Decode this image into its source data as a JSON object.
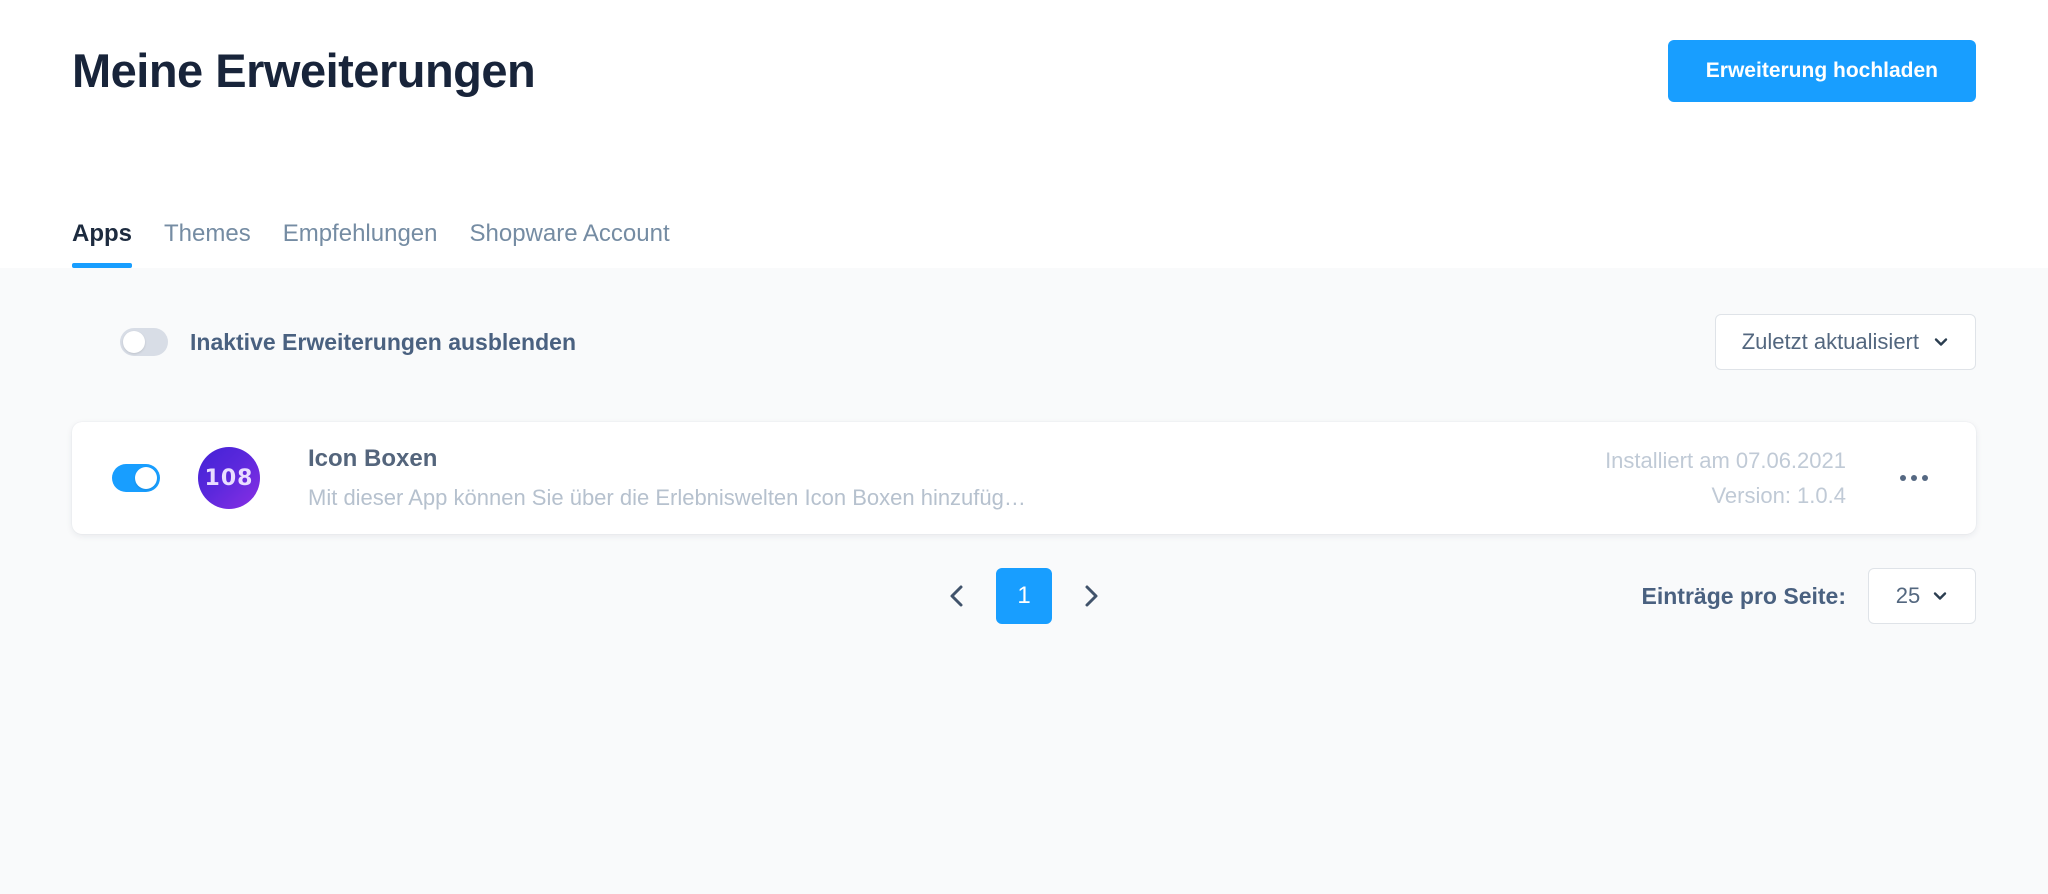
{
  "header": {
    "title": "Meine Erweiterungen",
    "upload_button": "Erweiterung hochladen"
  },
  "tabs": [
    {
      "label": "Apps",
      "active": true
    },
    {
      "label": "Themes",
      "active": false
    },
    {
      "label": "Empfehlungen",
      "active": false
    },
    {
      "label": "Shopware Account",
      "active": false
    }
  ],
  "filter_bar": {
    "hide_inactive_label": "Inaktive Erweiterungen ausblenden",
    "hide_inactive_on": false,
    "sort_value": "Zuletzt aktualisiert"
  },
  "extensions": [
    {
      "active": true,
      "icon_text": "108",
      "name": "Icon Boxen",
      "description": "Mit dieser App können Sie über die Erlebniswelten Icon Boxen hinzufüg…",
      "installed_at": "Installiert am 07.06.2021",
      "version": "Version: 1.0.4"
    }
  ],
  "pagination": {
    "prev_icon": "chevron-left-icon",
    "next_icon": "chevron-right-icon",
    "current_page": "1",
    "per_page_label": "Einträge pro Seite:",
    "per_page_value": "25"
  },
  "colors": {
    "accent": "#189eff",
    "page_background": "#f9fafb",
    "surface": "#ffffff",
    "text_primary": "#18243a",
    "text_muted": "#758ca3",
    "text_faint": "#c0cad6"
  }
}
